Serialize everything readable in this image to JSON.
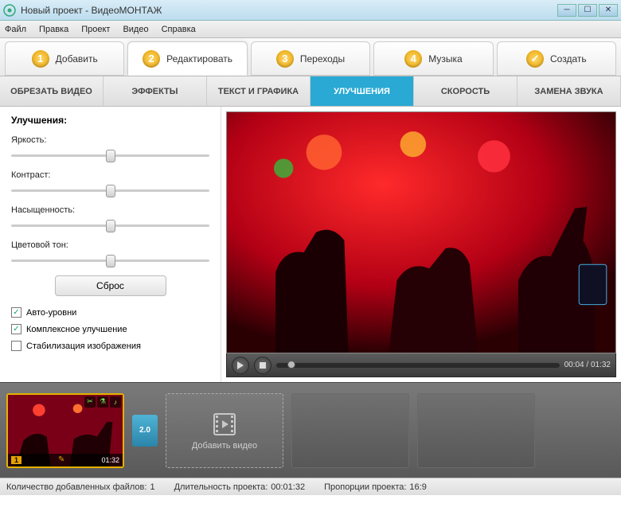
{
  "titlebar": {
    "title": "Новый проект - ВидеоМОНТАЖ"
  },
  "menu": {
    "file": "Файл",
    "edit": "Правка",
    "project": "Проект",
    "video": "Видео",
    "help": "Справка"
  },
  "steps": {
    "s1": {
      "num": "1",
      "label": "Добавить"
    },
    "s2": {
      "num": "2",
      "label": "Редактировать"
    },
    "s3": {
      "num": "3",
      "label": "Переходы"
    },
    "s4": {
      "num": "4",
      "label": "Музыка"
    },
    "s5": {
      "label": "Создать"
    }
  },
  "subtabs": {
    "crop": "ОБРЕЗАТЬ ВИДЕО",
    "effects": "ЭФФЕКТЫ",
    "text": "ТЕКСТ И ГРАФИКА",
    "enhance": "УЛУЧШЕНИЯ",
    "speed": "СКОРОСТЬ",
    "audio": "ЗАМЕНА ЗВУКА"
  },
  "enhance": {
    "title": "Улучшения:",
    "brightness": "Яркость:",
    "contrast": "Контраст:",
    "saturation": "Насыщенность:",
    "hue": "Цветовой тон:",
    "reset": "Сброс",
    "auto": "Авто-уровни",
    "complex": "Комплексное улучшение",
    "stab": "Стабилизация изображения",
    "checks": {
      "auto": true,
      "complex": true,
      "stab": false
    }
  },
  "player": {
    "current": "00:04",
    "sep": " / ",
    "total": "01:32"
  },
  "timeline": {
    "clip1": {
      "index": "1",
      "duration": "01:32"
    },
    "transition_label": "2.0",
    "add_label": "Добавить видео"
  },
  "status": {
    "files_label": "Количество добавленных файлов:",
    "files_value": "1",
    "duration_label": "Длительность проекта:",
    "duration_value": "00:01:32",
    "aspect_label": "Пропорции проекта:",
    "aspect_value": "16:9"
  }
}
